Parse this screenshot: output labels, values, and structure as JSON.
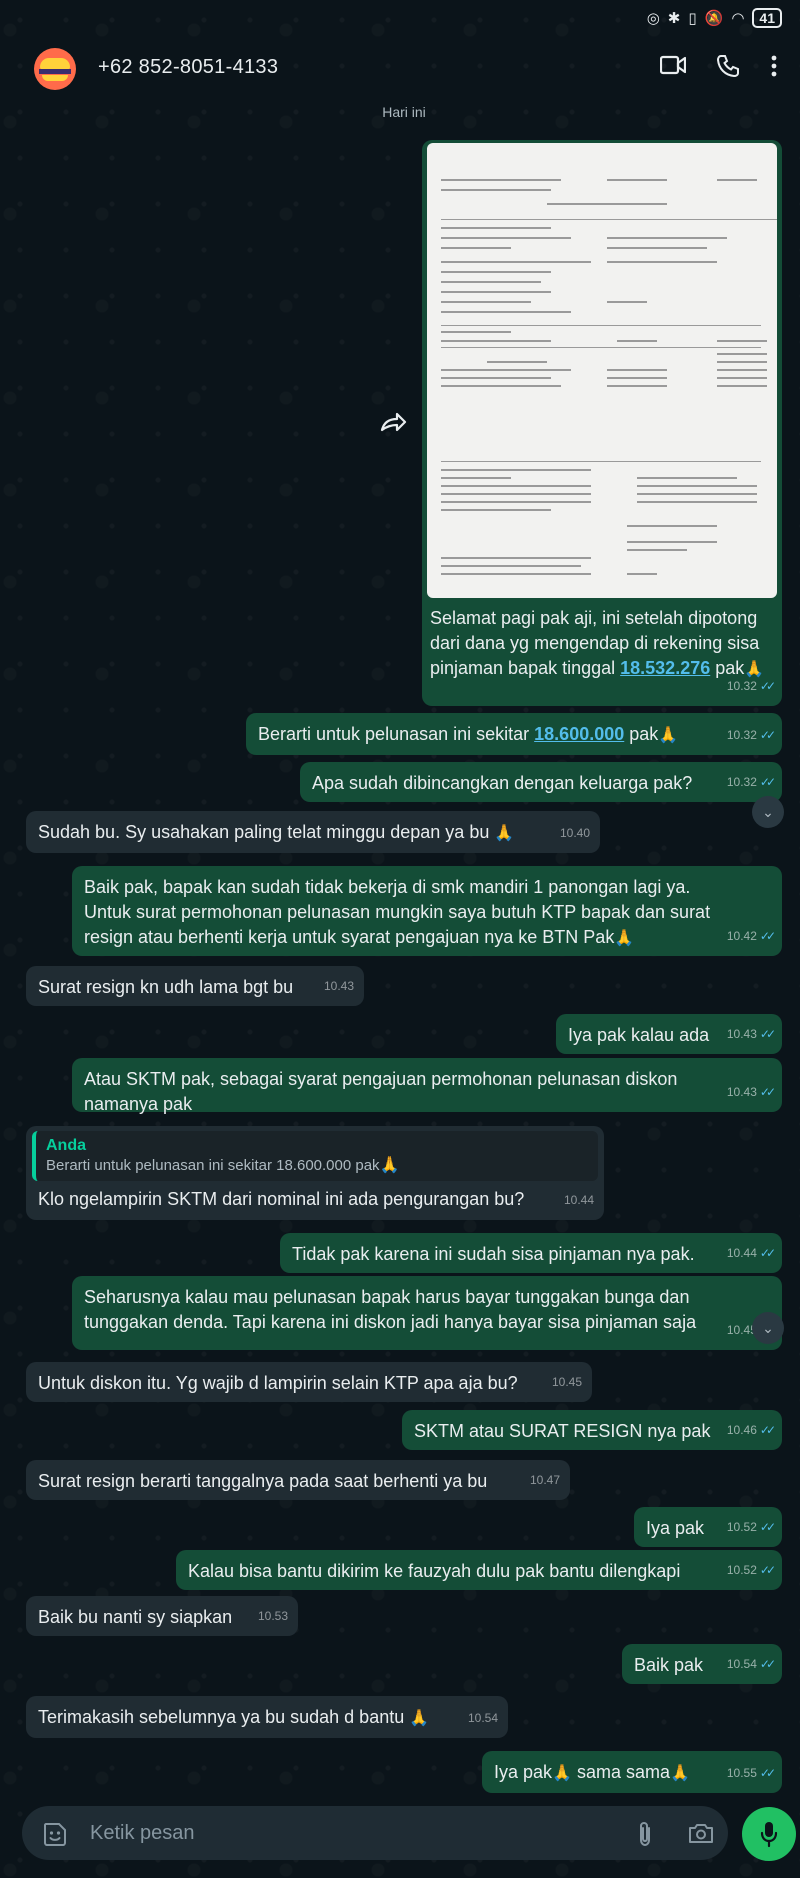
{
  "status_bar": {
    "battery": "41"
  },
  "header": {
    "contact": "+62 852-8051-4133"
  },
  "date_chip": "Hari ini",
  "messages": [
    {
      "text_a": "Selamat pagi pak aji, ini setelah dipotong dari dana yg mengendap di rekening sisa pinjaman bapak tinggal ",
      "link": "18.532.276",
      "text_b": " pak",
      "emoji": "🙏",
      "time": "10.32"
    },
    {
      "text_a": "Berarti untuk pelunasan ini sekitar ",
      "link": "18.600.000",
      "text_b": " pak",
      "emoji": "🙏",
      "time": "10.32"
    },
    {
      "text": "Apa sudah dibincangkan dengan keluarga pak?",
      "time": "10.32"
    },
    {
      "text": "Sudah bu. Sy usahakan paling telat minggu depan ya bu ",
      "emoji": "🙏",
      "time": "10.40"
    },
    {
      "text": "Baik pak, bapak kan sudah tidak bekerja di smk mandiri 1 panongan lagi ya. Untuk surat permohonan pelunasan mungkin saya butuh KTP bapak dan surat resign atau berhenti kerja untuk syarat pengajuan nya ke BTN Pak",
      "emoji": "🙏",
      "time": "10.42"
    },
    {
      "text": "Surat resign kn udh lama bgt bu",
      "time": "10.43"
    },
    {
      "text": "Iya pak kalau ada",
      "time": "10.43"
    },
    {
      "text": "Atau SKTM pak, sebagai syarat pengajuan permohonan pelunasan diskon namanya pak",
      "time": "10.43"
    },
    {
      "quote_author": "Anda",
      "quote_text": "Berarti untuk pelunasan ini sekitar 18.600.000 pak",
      "quote_emoji": "🙏",
      "text": "Klo ngelampirin SKTM dari nominal ini ada pengurangan bu?",
      "time": "10.44"
    },
    {
      "text": "Tidak pak karena ini sudah sisa pinjaman nya pak.",
      "time": "10.44"
    },
    {
      "text": "Seharusnya kalau mau pelunasan bapak harus bayar tunggakan bunga dan tunggakan denda. Tapi karena ini diskon jadi hanya bayar sisa pinjaman saja",
      "time": "10.45"
    },
    {
      "text": "Untuk diskon itu. Yg wajib d lampirin selain KTP apa aja bu?",
      "time": "10.45"
    },
    {
      "text": "SKTM atau SURAT RESIGN nya pak",
      "time": "10.46"
    },
    {
      "text": "Surat resign berarti tanggalnya pada saat berhenti ya bu",
      "time": "10.47"
    },
    {
      "text": "Iya pak",
      "time": "10.52"
    },
    {
      "text": "Kalau bisa bantu dikirim ke fauzyah dulu pak bantu dilengkapi",
      "time": "10.52"
    },
    {
      "text": "Baik bu nanti sy siapkan",
      "time": "10.53"
    },
    {
      "text": "Baik pak",
      "time": "10.54"
    },
    {
      "text": "Terimakasih sebelumnya ya bu sudah d bantu ",
      "emoji": "🙏",
      "time": "10.54"
    },
    {
      "text_a": "Iya pak",
      "emoji": "🙏",
      "text_b": " sama sama",
      "emoji2": "🙏",
      "time": "10.55"
    }
  ],
  "input": {
    "placeholder": "Ketik pesan"
  },
  "colors": {
    "outgoing": "#144d37",
    "incoming": "#202c33",
    "accent": "#21c063",
    "link": "#53bdeb"
  }
}
